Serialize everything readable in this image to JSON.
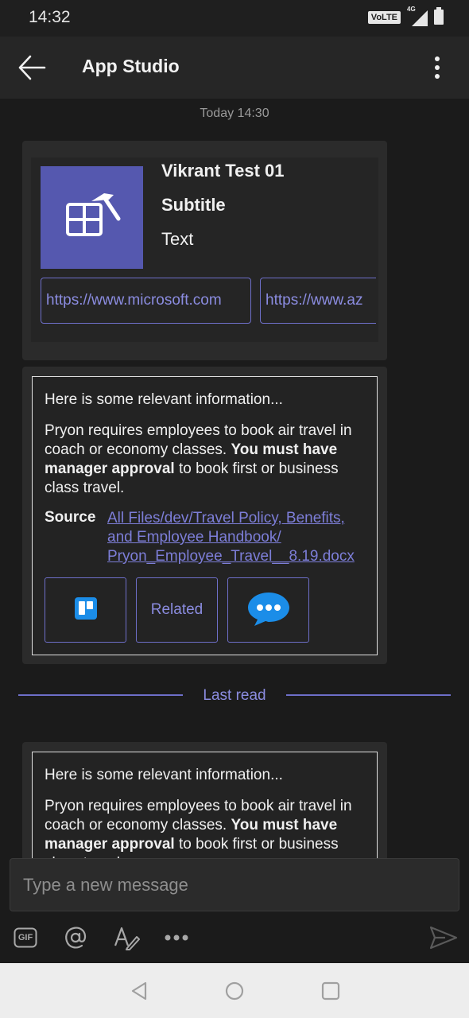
{
  "status_bar": {
    "time": "14:32",
    "volte_label": "VoLTE",
    "network_label": "4G",
    "icons": [
      "volte-icon",
      "signal-icon",
      "battery-icon"
    ]
  },
  "app_bar": {
    "title": "App Studio",
    "back_icon": "back-arrow-icon",
    "more_icon": "more-vertical-icon"
  },
  "chat": {
    "timestamp": "Today 14:30",
    "hero_card": {
      "title": "Vikrant Test 01",
      "subtitle": "Subtitle",
      "text": "Text",
      "image_icon": "app-studio-icon",
      "image_color": "#5558af",
      "buttons": [
        "https://www.microsoft.com",
        "https://www.az"
      ]
    },
    "answer_card": {
      "intro": "Here is some relevant information...",
      "body_part1": "Pryon requires employees to book air travel in coach or economy classes. ",
      "body_bold": "You must have manager approval",
      "body_part2": " to book first or business class travel.",
      "source_label": "Source",
      "source_link": "All Files/dev/Travel Policy, Benefits, and Employee Handbook/ Pryon_Employee_Travel__8.19.docx",
      "actions": [
        {
          "icon": "trello-icon",
          "label": ""
        },
        {
          "icon": "",
          "label": "Related"
        },
        {
          "icon": "chat-bubble-icon",
          "label": ""
        }
      ]
    },
    "last_read_label": "Last read",
    "answer_card_2": {
      "intro": "Here is some relevant information...",
      "body_part1": "Pryon requires employees to book air travel in coach or economy classes. ",
      "body_bold": "You must have manager approval",
      "body_part2": " to book first or business class travel."
    }
  },
  "compose": {
    "placeholder": "Type a new message",
    "tools": [
      "gif-icon",
      "mention-icon",
      "format-icon",
      "more-horizontal-icon"
    ],
    "gif_label": "GIF",
    "send_icon": "send-icon"
  },
  "nav_bar": {
    "icons": [
      "nav-back-icon",
      "nav-home-icon",
      "nav-recents-icon"
    ]
  },
  "colors": {
    "accent": "#6e6fc9",
    "accent_text": "#8b8ce0",
    "background": "#1b1b1b",
    "card": "#2b2b2b"
  }
}
